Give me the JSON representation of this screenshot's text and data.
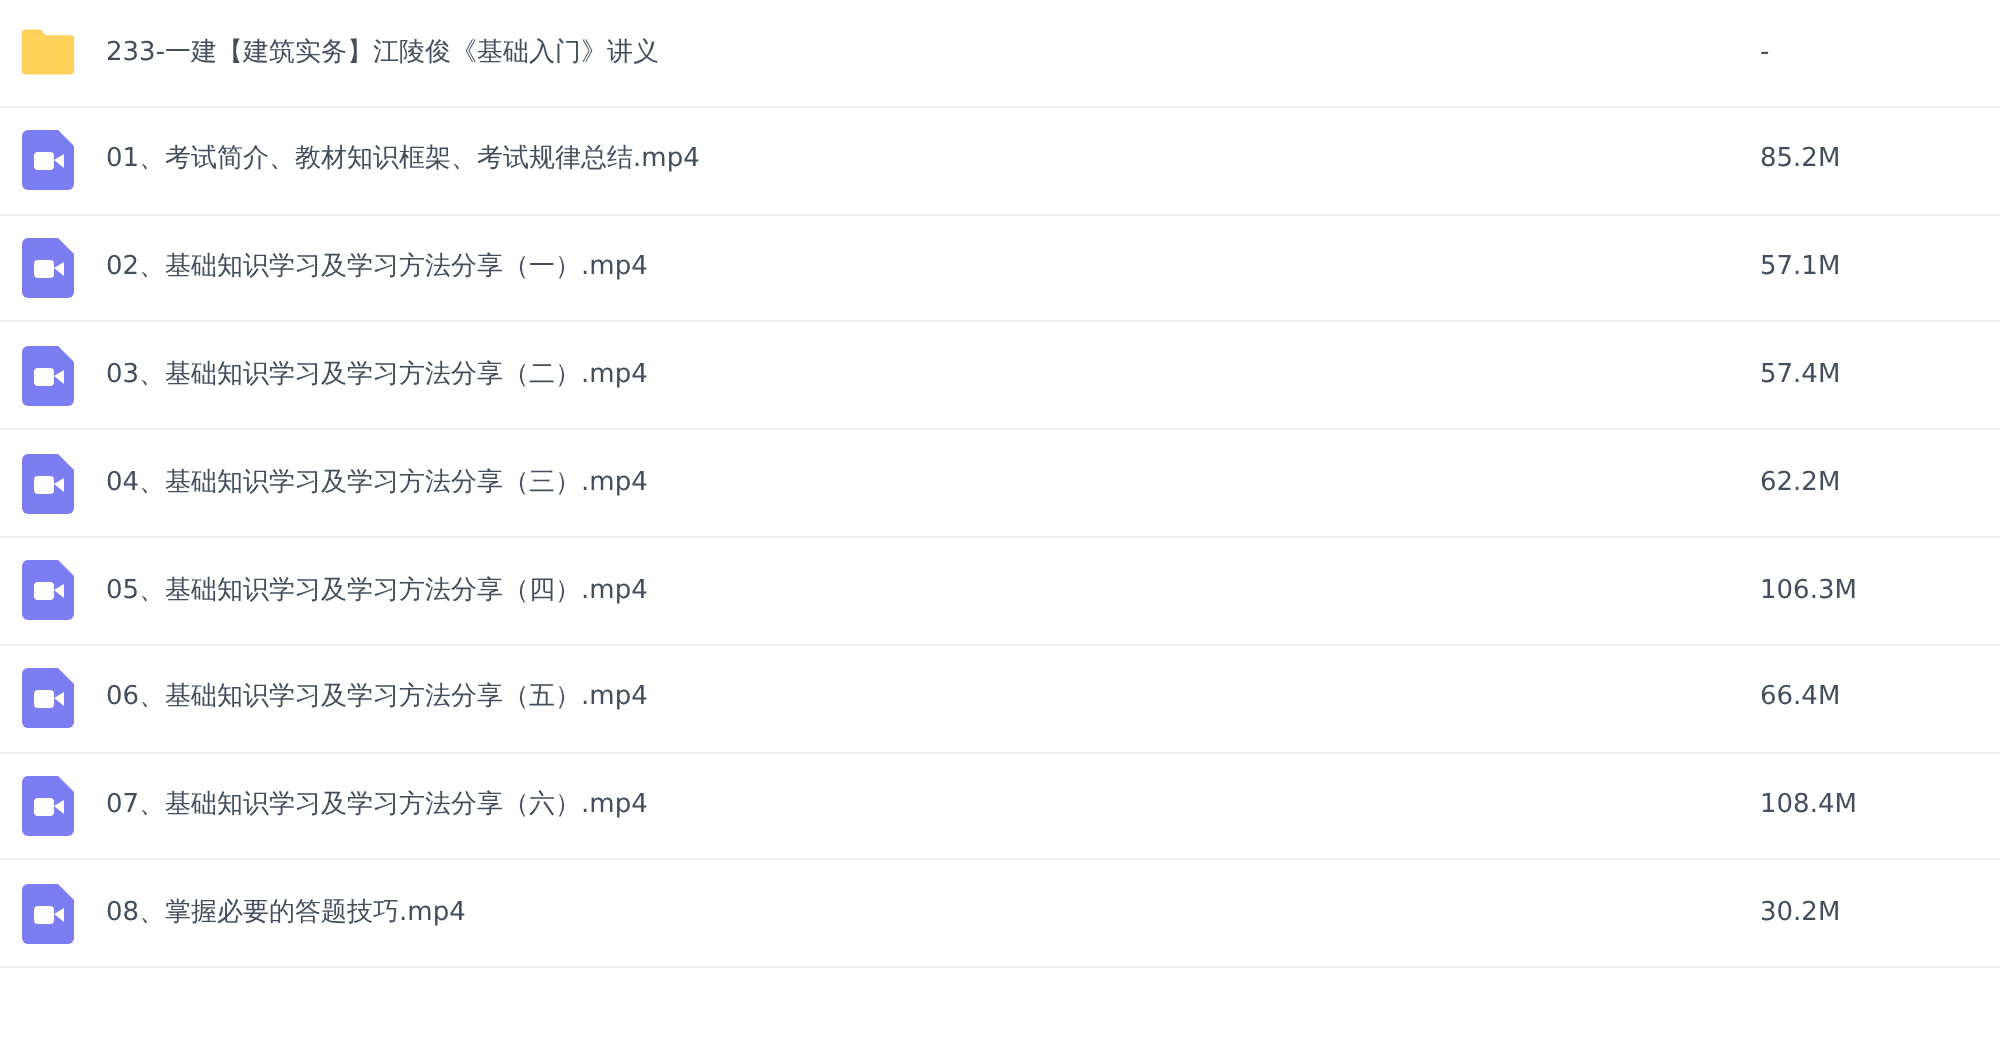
{
  "files": [
    {
      "kind": "folder",
      "name": "233-一建【建筑实务】江陵俊《基础入门》讲义",
      "size": "-"
    },
    {
      "kind": "video",
      "name": "01、考试简介、教材知识框架、考试规律总结.mp4",
      "size": "85.2M"
    },
    {
      "kind": "video",
      "name": "02、基础知识学习及学习方法分享（一）.mp4",
      "size": "57.1M"
    },
    {
      "kind": "video",
      "name": "03、基础知识学习及学习方法分享（二）.mp4",
      "size": "57.4M"
    },
    {
      "kind": "video",
      "name": "04、基础知识学习及学习方法分享（三）.mp4",
      "size": "62.2M"
    },
    {
      "kind": "video",
      "name": "05、基础知识学习及学习方法分享（四）.mp4",
      "size": "106.3M"
    },
    {
      "kind": "video",
      "name": "06、基础知识学习及学习方法分享（五）.mp4",
      "size": "66.4M"
    },
    {
      "kind": "video",
      "name": "07、基础知识学习及学习方法分享（六）.mp4",
      "size": "108.4M"
    },
    {
      "kind": "video",
      "name": "08、掌握必要的答题技巧.mp4",
      "size": "30.2M"
    }
  ]
}
